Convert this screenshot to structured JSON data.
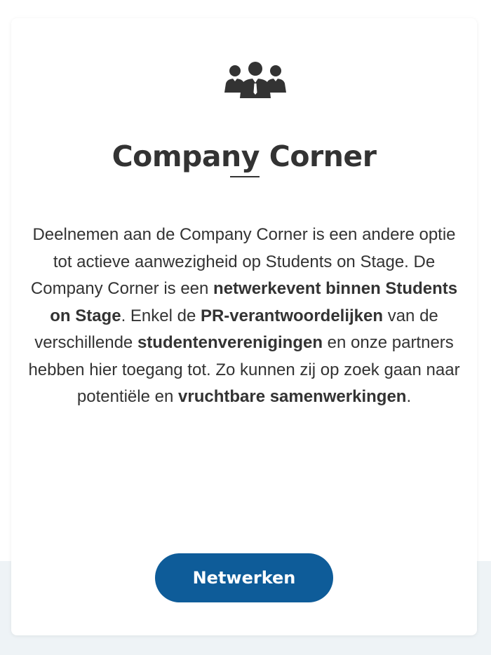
{
  "card": {
    "icon": "team-icon",
    "title": "Company Corner",
    "body": {
      "intro": "Deelnemen aan de Company Corner is een andere optie tot actieve aanwezigheid op Students on Stage. De Company Corner is een ",
      "bold1": "netwerkevent binnen Students on Stage",
      "mid1": ". Enkel de ",
      "bold2": "PR-verantwoordelijken",
      "mid2": " van de verschillende ",
      "bold3": "studentenverenigingen",
      "mid3": " en onze partners hebben hier toegang tot. Zo kunnen zij op zoek gaan naar potentiële en ",
      "bold4": "vruchtbare samenwerkingen",
      "end": "."
    },
    "button_label": "Netwerken"
  },
  "colors": {
    "text": "#333333",
    "button": "#0e5c99",
    "button_text": "#ffffff",
    "page_bottom": "#eef3f6"
  }
}
